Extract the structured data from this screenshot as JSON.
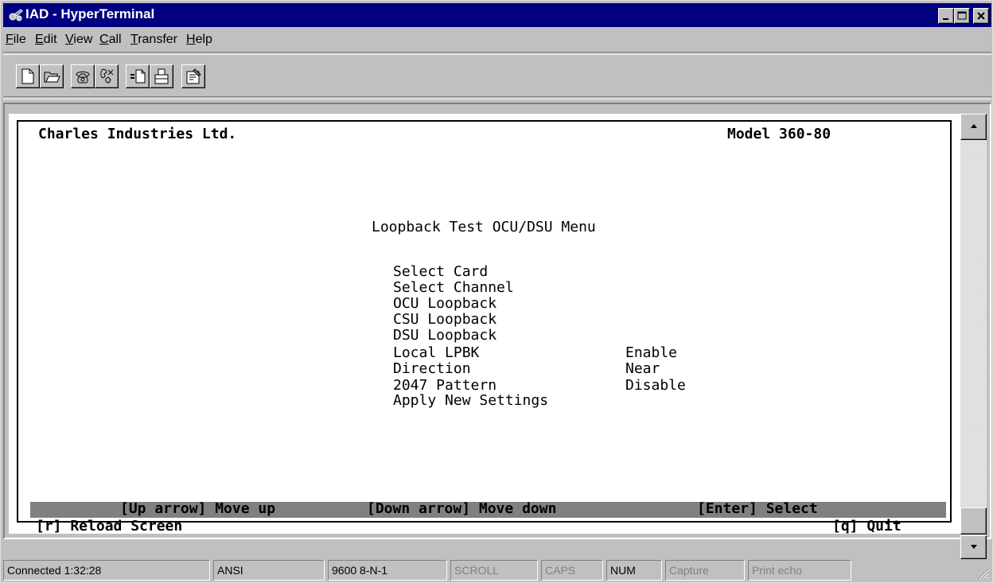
{
  "window": {
    "title": "IAD - HyperTerminal"
  },
  "menu": [
    {
      "accel": "F",
      "rest": "ile"
    },
    {
      "accel": "E",
      "rest": "dit"
    },
    {
      "accel": "V",
      "rest": "iew"
    },
    {
      "accel": "C",
      "rest": "all"
    },
    {
      "accel": "T",
      "rest": "ransfer"
    },
    {
      "accel": "H",
      "rest": "elp"
    }
  ],
  "toolbar": {
    "icons": [
      "new-document-icon",
      "open-folder-icon",
      "connect-phone-icon",
      "disconnect-phone-icon",
      "send-file-icon",
      "receive-file-icon",
      "properties-icon"
    ]
  },
  "terminal": {
    "company": "Charles Industries Ltd.",
    "model": "Model 360-80",
    "menu_title": "Loopback Test OCU/DSU Menu",
    "items": [
      {
        "label": "Select Card",
        "value": ""
      },
      {
        "label": "Select Channel",
        "value": ""
      },
      {
        "label": "OCU Loopback",
        "value": ""
      },
      {
        "label": "CSU Loopback",
        "value": ""
      },
      {
        "label": "DSU Loopback",
        "value": ""
      },
      {
        "label": "Local LPBK",
        "value": "Enable"
      },
      {
        "label": "Direction",
        "value": "Near"
      },
      {
        "label": "2047 Pattern",
        "value": "Disable"
      },
      {
        "label": "Apply New Settings",
        "value": ""
      }
    ],
    "hints": {
      "up": "[Up arrow] Move up",
      "down": "[Down arrow] Move down",
      "enter": "[Enter] Select"
    },
    "reload": "[r] Reload Screen",
    "quit": "[q] Quit"
  },
  "status": {
    "connected": "Connected 1:32:28",
    "emulation": "ANSI",
    "port": "9600 8-N-1",
    "scroll": "SCROLL",
    "caps": "CAPS",
    "num": "NUM",
    "capture": "Capture",
    "print_echo": "Print echo"
  },
  "colors": {
    "titlebar": "#000080",
    "chrome": "#c0c0c0",
    "hint_bar": "#808080",
    "terminal_bg": "#ffffff"
  }
}
